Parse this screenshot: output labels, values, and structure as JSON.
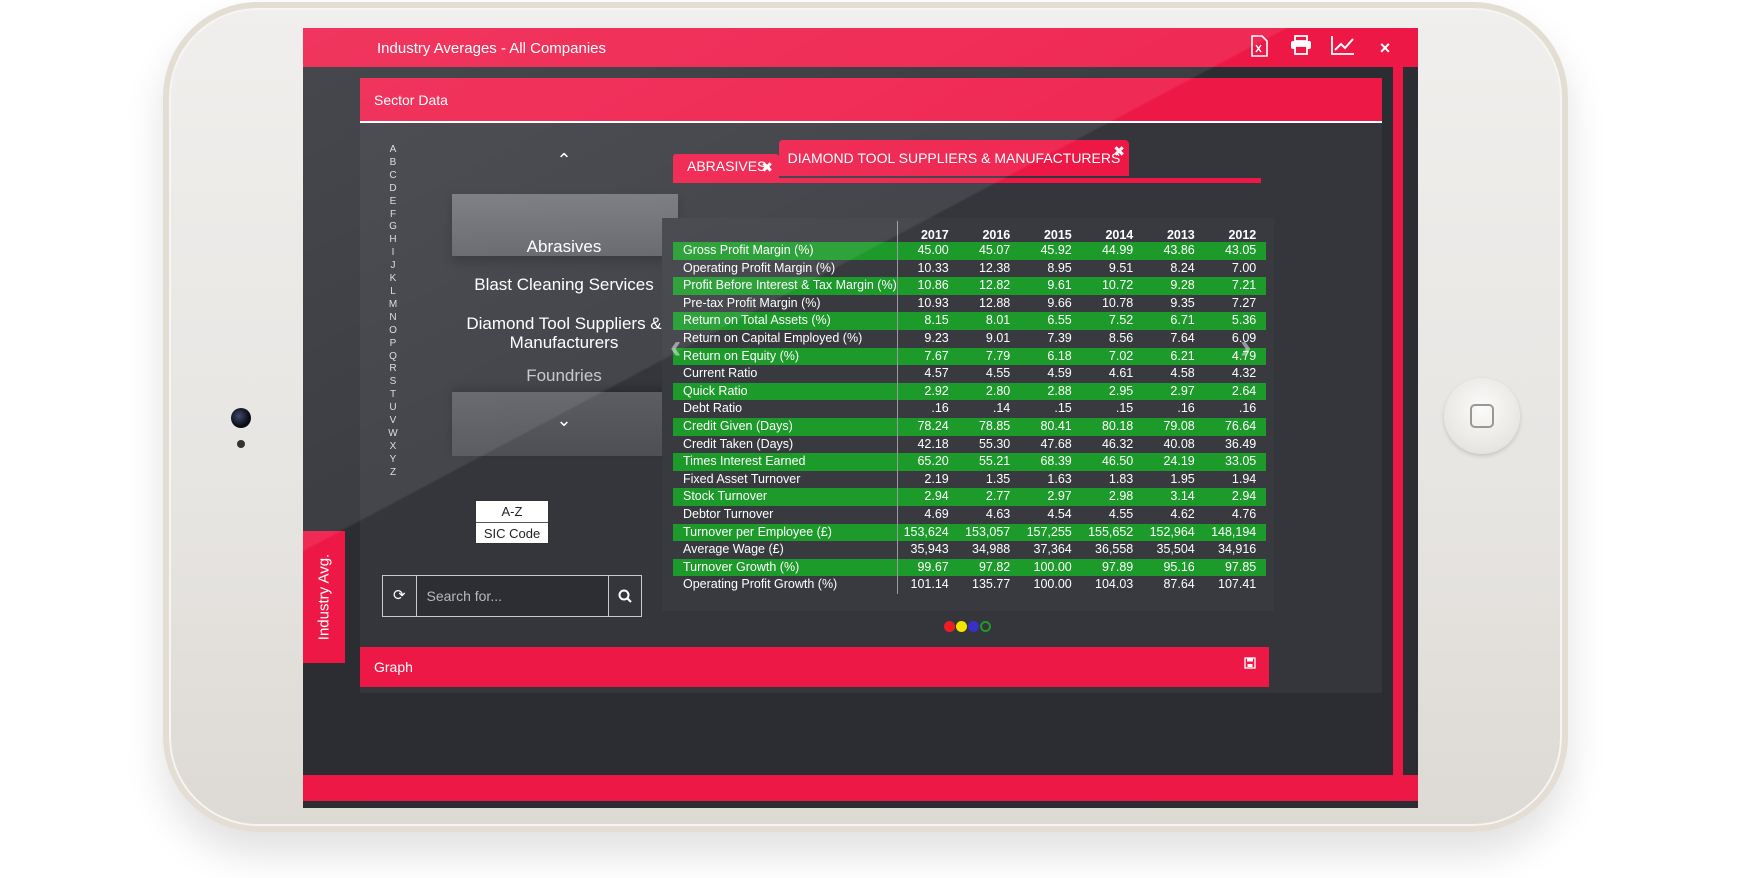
{
  "window": {
    "title": "Industry Averages - All Companies",
    "icons": [
      "excel-icon",
      "print-icon",
      "chart-icon",
      "close-icon"
    ],
    "close_glyph": "×"
  },
  "side_tab": {
    "label": "Industry Avg."
  },
  "sector": {
    "title": "Sector Data"
  },
  "alphabet": [
    "A",
    "B",
    "C",
    "D",
    "E",
    "F",
    "G",
    "H",
    "I",
    "J",
    "K",
    "L",
    "M",
    "N",
    "O",
    "P",
    "Q",
    "R",
    "S",
    "T",
    "U",
    "V",
    "W",
    "X",
    "Y",
    "Z"
  ],
  "picker": {
    "items": [
      "Abrasives",
      "Blast Cleaning Services",
      "Diamond Tool Suppliers & Manufacturers",
      "Foundries"
    ],
    "up_glyph": "⌃",
    "down_glyph": "⌄"
  },
  "sort": {
    "az_label": "A-Z",
    "sic_label": "SIC Code"
  },
  "search": {
    "placeholder": "Search for...",
    "value": ""
  },
  "tabs": [
    {
      "label": "ABRASIVES",
      "close": "✖"
    },
    {
      "label": "DIAMOND TOOL SUPPLIERS & MANUFACTURERS",
      "close": "✖"
    }
  ],
  "table": {
    "columns": [
      "2017",
      "2016",
      "2015",
      "2014",
      "2013",
      "2012"
    ],
    "rows": [
      {
        "label": "Gross Profit Margin (%)",
        "values": [
          "45.00",
          "45.07",
          "45.92",
          "44.99",
          "43.86",
          "43.05"
        ]
      },
      {
        "label": "Operating Profit Margin (%)",
        "values": [
          "10.33",
          "12.38",
          "8.95",
          "9.51",
          "8.24",
          "7.00"
        ]
      },
      {
        "label": "Profit Before Interest & Tax Margin (%)",
        "values": [
          "10.86",
          "12.82",
          "9.61",
          "10.72",
          "9.28",
          "7.21"
        ]
      },
      {
        "label": "Pre-tax Profit Margin (%)",
        "values": [
          "10.93",
          "12.88",
          "9.66",
          "10.78",
          "9.35",
          "7.27"
        ]
      },
      {
        "label": "Return on Total Assets (%)",
        "values": [
          "8.15",
          "8.01",
          "6.55",
          "7.52",
          "6.71",
          "5.36"
        ]
      },
      {
        "label": "Return on Capital Employed (%)",
        "values": [
          "9.23",
          "9.01",
          "7.39",
          "8.56",
          "7.64",
          "6.09"
        ]
      },
      {
        "label": "Return on Equity (%)",
        "values": [
          "7.67",
          "7.79",
          "6.18",
          "7.02",
          "6.21",
          "4.79"
        ]
      },
      {
        "label": "Current Ratio",
        "values": [
          "4.57",
          "4.55",
          "4.59",
          "4.61",
          "4.58",
          "4.32"
        ]
      },
      {
        "label": "Quick Ratio",
        "values": [
          "2.92",
          "2.80",
          "2.88",
          "2.95",
          "2.97",
          "2.64"
        ]
      },
      {
        "label": "Debt Ratio",
        "values": [
          ".16",
          ".14",
          ".15",
          ".15",
          ".16",
          ".16"
        ]
      },
      {
        "label": "Credit Given (Days)",
        "values": [
          "78.24",
          "78.85",
          "80.41",
          "80.18",
          "79.08",
          "76.64"
        ]
      },
      {
        "label": "Credit Taken (Days)",
        "values": [
          "42.18",
          "55.30",
          "47.68",
          "46.32",
          "40.08",
          "36.49"
        ]
      },
      {
        "label": "Times Interest Earned",
        "values": [
          "65.20",
          "55.21",
          "68.39",
          "46.50",
          "24.19",
          "33.05"
        ]
      },
      {
        "label": "Fixed Asset Turnover",
        "values": [
          "2.19",
          "1.35",
          "1.63",
          "1.83",
          "1.95",
          "1.94"
        ]
      },
      {
        "label": "Stock Turnover",
        "values": [
          "2.94",
          "2.77",
          "2.97",
          "2.98",
          "3.14",
          "2.94"
        ]
      },
      {
        "label": "Debtor Turnover",
        "values": [
          "4.69",
          "4.63",
          "4.54",
          "4.55",
          "4.62",
          "4.76"
        ]
      },
      {
        "label": "Turnover per Employee (£)",
        "values": [
          "153,624",
          "153,057",
          "157,255",
          "155,652",
          "152,964",
          "148,194"
        ]
      },
      {
        "label": "Average Wage (£)",
        "values": [
          "35,943",
          "34,988",
          "37,364",
          "36,558",
          "35,504",
          "34,916"
        ]
      },
      {
        "label": "Turnover Growth (%)",
        "values": [
          "99.67",
          "97.82",
          "100.00",
          "97.89",
          "95.16",
          "97.85"
        ]
      },
      {
        "label": "Operating Profit Growth (%)",
        "values": [
          "101.14",
          "135.77",
          "100.00",
          "104.03",
          "87.64",
          "107.41"
        ]
      }
    ]
  },
  "pager": {
    "prev_glyph": "‹",
    "next_glyph": "›",
    "dot_colors": [
      "#ee1c25",
      "#f2e600",
      "#3b2fc9",
      "#1c9a2a"
    ]
  },
  "graph": {
    "title": "Graph"
  },
  "colors": {
    "accent": "#ee1846",
    "row_green": "#1c9a2a",
    "panel": "#34363c"
  }
}
